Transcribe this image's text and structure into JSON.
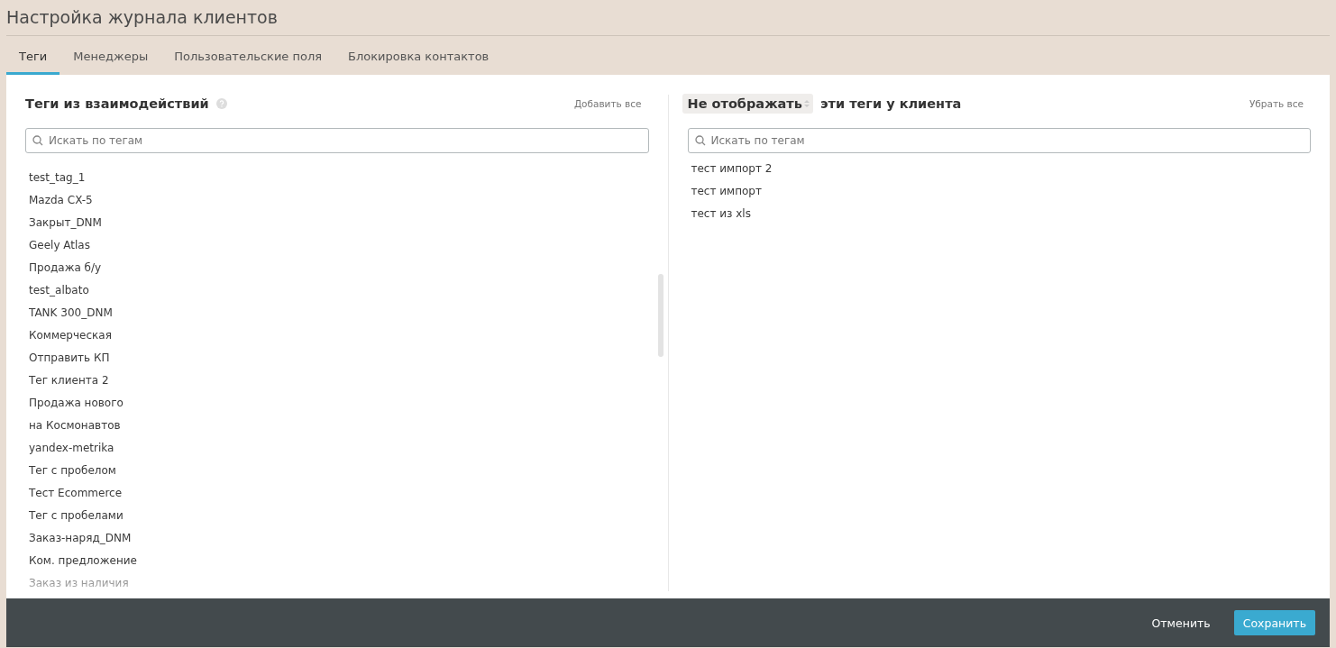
{
  "window": {
    "title": "Настройка журнала клиентов"
  },
  "tabs": [
    {
      "label": "Теги",
      "selected": true
    },
    {
      "label": "Менеджеры",
      "selected": false
    },
    {
      "label": "Пользовательские поля",
      "selected": false
    },
    {
      "label": "Блокировка контактов",
      "selected": false
    }
  ],
  "left_panel": {
    "title": "Теги из взаимодействий",
    "action": "Добавить все",
    "search": {
      "placeholder": "Искать по тегам"
    },
    "tags": [
      "test_tag_1",
      "Mazda CX-5",
      "Закрыт_DNM",
      "Geely Atlas",
      "Продажа б/у",
      "test_albato",
      "TANK 300_DNM",
      "Коммерческая",
      "Отправить КП",
      "Тег клиента 2",
      "Продажа нового",
      "на Космонавтов",
      "yandex-metrika",
      "Тег с пробелом",
      "Тест Ecommerce",
      "Тег с пробелами",
      "Заказ-наряд_DNM",
      "Ком. предложение",
      "Заказ из наличия"
    ]
  },
  "right_panel": {
    "mode_select": "Не отображать",
    "title": "эти теги у клиента",
    "action": "Убрать все",
    "search": {
      "placeholder": "Искать по тегам"
    },
    "tags": [
      "тест импорт 2",
      "тест импорт",
      "тест из xls"
    ]
  },
  "footer": {
    "buttons": [
      {
        "label": "Отменить",
        "kind": "secondary"
      },
      {
        "label": "Сохранить",
        "kind": "primary"
      }
    ]
  }
}
